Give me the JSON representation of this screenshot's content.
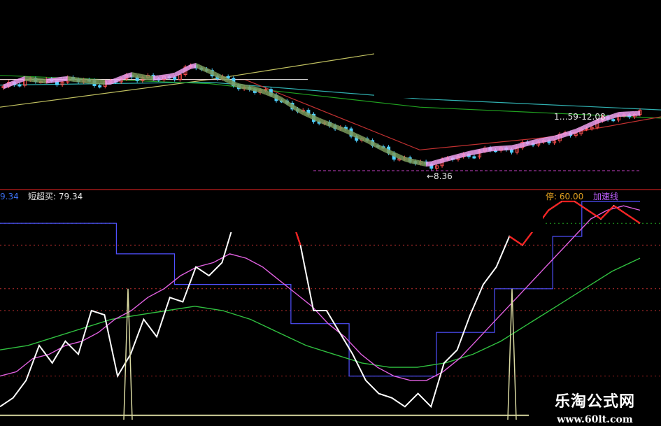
{
  "chart_data": [
    {
      "type": "candlestick",
      "panel": "price",
      "title": "",
      "annotations": [
        {
          "label": "←8.36",
          "kind": "low-marker"
        },
        {
          "label": "1…59-12.08",
          "kind": "range-marker"
        }
      ],
      "candles_trend": [
        14,
        14.6,
        14.4,
        14.6,
        14.4,
        14.3,
        14.9,
        14.6,
        14.8,
        15.6,
        14.9,
        14.1,
        13.8,
        13.2,
        12.2,
        11.5,
        10.9,
        10.2,
        9.4,
        8.7,
        8.36,
        8.8,
        9.2,
        9.5,
        9.6,
        10.0,
        10.3,
        10.8,
        11.5,
        12.0,
        12.08
      ],
      "series": [
        {
          "name": "",
          "color": "#c0c060",
          "kind": "ma-long"
        },
        {
          "name": "",
          "color": "#30b0b0",
          "kind": "ma-mid"
        },
        {
          "name": "",
          "color": "#20a020",
          "kind": "ma-slow"
        },
        {
          "name": "",
          "color": "#c03030",
          "kind": "ma-fast"
        }
      ],
      "colors": {
        "up": "#ff5050",
        "down": "#50d0ff",
        "ribbon_down": "#7a9a5a",
        "ribbon_up": "#f0a0f0"
      }
    },
    {
      "type": "line",
      "panel": "indicator",
      "legend": [
        {
          "label": "9.34",
          "color": "#3c6ff0"
        },
        {
          "label": "短超买: 79.34",
          "color": "#e8e8e8"
        },
        {
          "label": "停: 60.00",
          "color": "#e0a020"
        },
        {
          "label": "加速线",
          "color": "#c060ff"
        }
      ],
      "ylim": [
        0,
        100
      ],
      "ref_levels": [
        90,
        80,
        60,
        50,
        20
      ],
      "series": [
        {
          "name": "",
          "color": "#ffffff",
          "values": [
            6,
            10,
            18,
            34,
            26,
            36,
            30,
            50,
            48,
            20,
            30,
            46,
            38,
            56,
            54,
            70,
            66,
            72,
            92,
            94,
            96,
            90,
            98,
            80,
            50,
            50,
            40,
            30,
            18,
            12,
            10,
            6,
            12,
            6,
            26,
            32,
            48,
            62,
            70,
            84,
            80,
            88,
            96,
            100,
            100,
            96,
            92,
            98,
            94,
            90
          ]
        },
        {
          "name": "",
          "color": "#e060e0",
          "values": [
            20,
            22,
            28,
            30,
            34,
            36,
            40,
            46,
            50,
            56,
            60,
            66,
            70,
            72,
            76,
            74,
            70,
            64,
            58,
            52,
            44,
            38,
            30,
            24,
            20,
            18,
            18,
            22,
            28,
            36,
            44,
            52,
            60,
            68,
            76,
            84,
            92,
            96,
            98,
            96
          ]
        },
        {
          "name": "",
          "color": "#30c040",
          "values": [
            32,
            34,
            38,
            42,
            46,
            48,
            50,
            52,
            50,
            46,
            40,
            34,
            30,
            26,
            24,
            24,
            26,
            30,
            36,
            44,
            52,
            60,
            68,
            74
          ]
        },
        {
          "name": "",
          "color": "#5050ff",
          "values": [
            90,
            90,
            90,
            90,
            76,
            76,
            62,
            62,
            62,
            62,
            44,
            44,
            20,
            20,
            20,
            40,
            40,
            60,
            60,
            84,
            100,
            100,
            100
          ]
        },
        {
          "name": "",
          "color": "#d8d8a0",
          "values": [
            0,
            0,
            0,
            100,
            0,
            0,
            0,
            0,
            0,
            0,
            0,
            0,
            100,
            0,
            0,
            0
          ]
        }
      ]
    }
  ],
  "labels": {
    "val": "9.34",
    "short": "短超买: 79.34",
    "right": "停: 60.00",
    "accel": "加速线",
    "low": "←8.36",
    "range": "1…59-12.08"
  },
  "watermark": {
    "title": "乐淘公式网",
    "url": "www.60lt.com"
  }
}
